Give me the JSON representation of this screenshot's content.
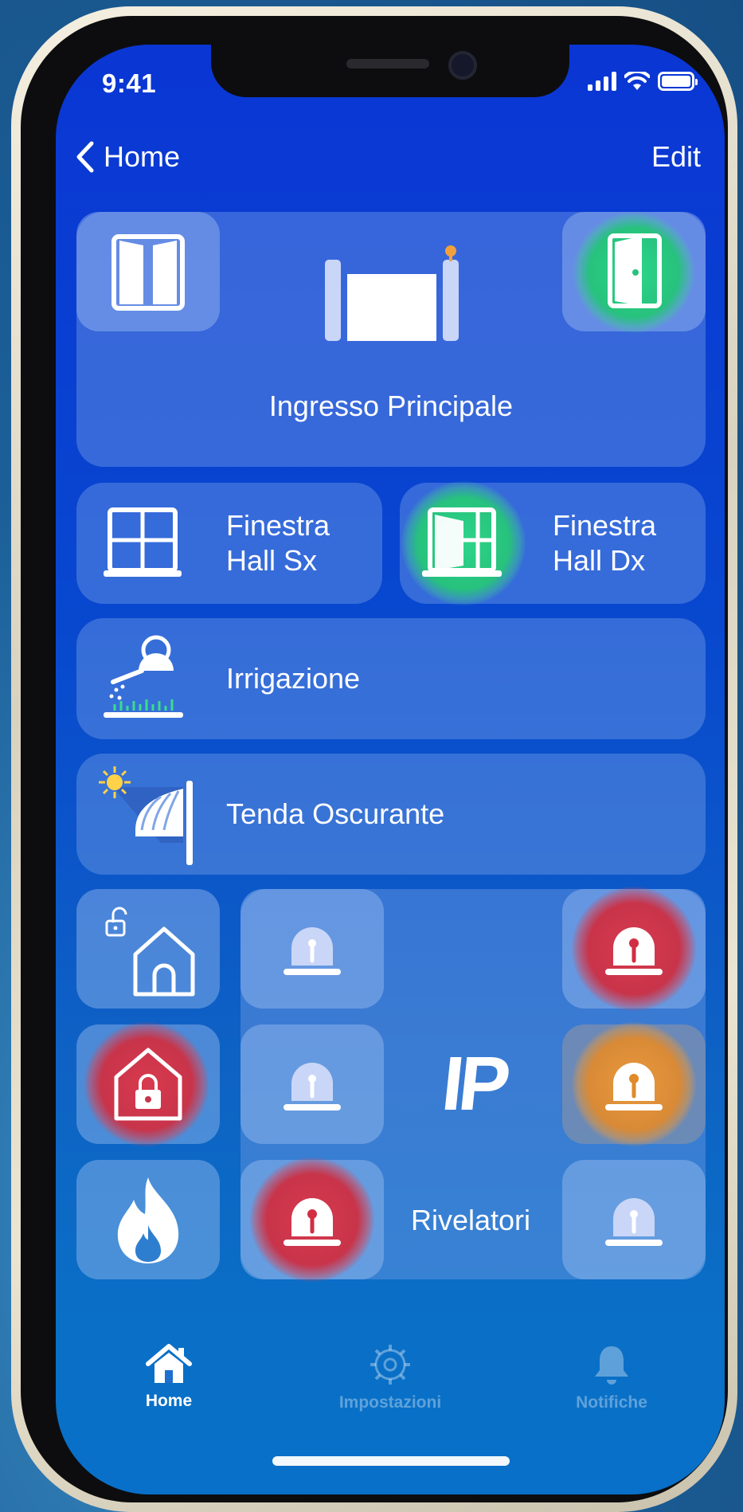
{
  "status_bar": {
    "time": "9:41"
  },
  "nav": {
    "back_label": "Home",
    "edit_label": "Edit"
  },
  "main_entrance": {
    "label": "Ingresso Principale"
  },
  "windows": [
    {
      "label_line1": "Finestra",
      "label_line2": "Hall Sx",
      "state": "closed"
    },
    {
      "label_line1": "Finestra",
      "label_line2": "Hall Dx",
      "state": "open"
    }
  ],
  "irrigation": {
    "label": "Irrigazione"
  },
  "awning": {
    "label": "Tenda Oscurante"
  },
  "security": {
    "ip_label": "IP",
    "detectors_label": "Rivelatori",
    "sirens": [
      {
        "state": "idle"
      },
      {
        "state": "alarm"
      },
      {
        "state": "idle"
      },
      {
        "state": "warning"
      },
      {
        "state": "alarm"
      },
      {
        "state": "idle"
      }
    ]
  },
  "tab_bar": {
    "tabs": [
      {
        "label": "Home",
        "icon": "house-icon",
        "active": true
      },
      {
        "label": "Impostazioni",
        "icon": "gear-icon",
        "active": false
      },
      {
        "label": "Notifiche",
        "icon": "bell-icon",
        "active": false
      }
    ]
  },
  "colors": {
    "accent_green": "#27c27d",
    "alarm_red": "#c8344a",
    "warning_orange": "#d98a36"
  }
}
